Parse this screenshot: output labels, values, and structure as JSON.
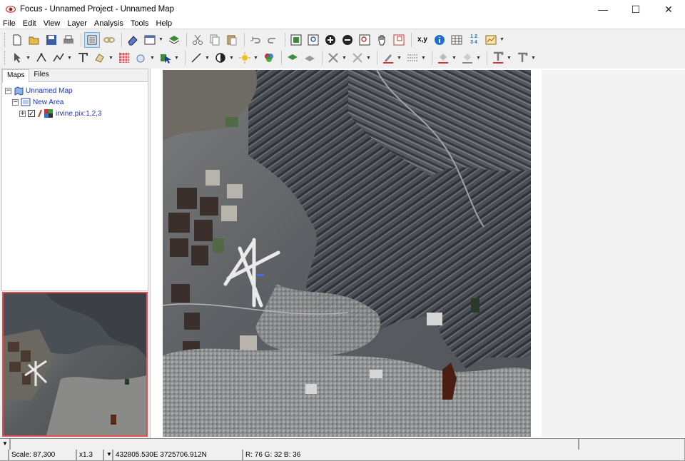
{
  "window": {
    "title": "Focus - Unnamed Project - Unnamed Map"
  },
  "menu": [
    "File",
    "Edit",
    "View",
    "Layer",
    "Analysis",
    "Tools",
    "Help"
  ],
  "tabs": [
    "Maps",
    "Files"
  ],
  "tree": {
    "map": "Unnamed Map",
    "area": "New Area",
    "layer": "irvine.pix:1,2,3"
  },
  "toolbar": {
    "xy_label": "x,y",
    "digits_label": "1 2 3 4"
  },
  "status": {
    "scale": "Scale: 87,300",
    "zoom": "x1.3",
    "coords": "432805.530E 3725706.912N",
    "rgb": "R: 76 G: 32 B: 36"
  },
  "colors": {
    "tree_text": "#1533cf",
    "overview_border": "#e05050",
    "selected_tool": "#cde3f7"
  }
}
